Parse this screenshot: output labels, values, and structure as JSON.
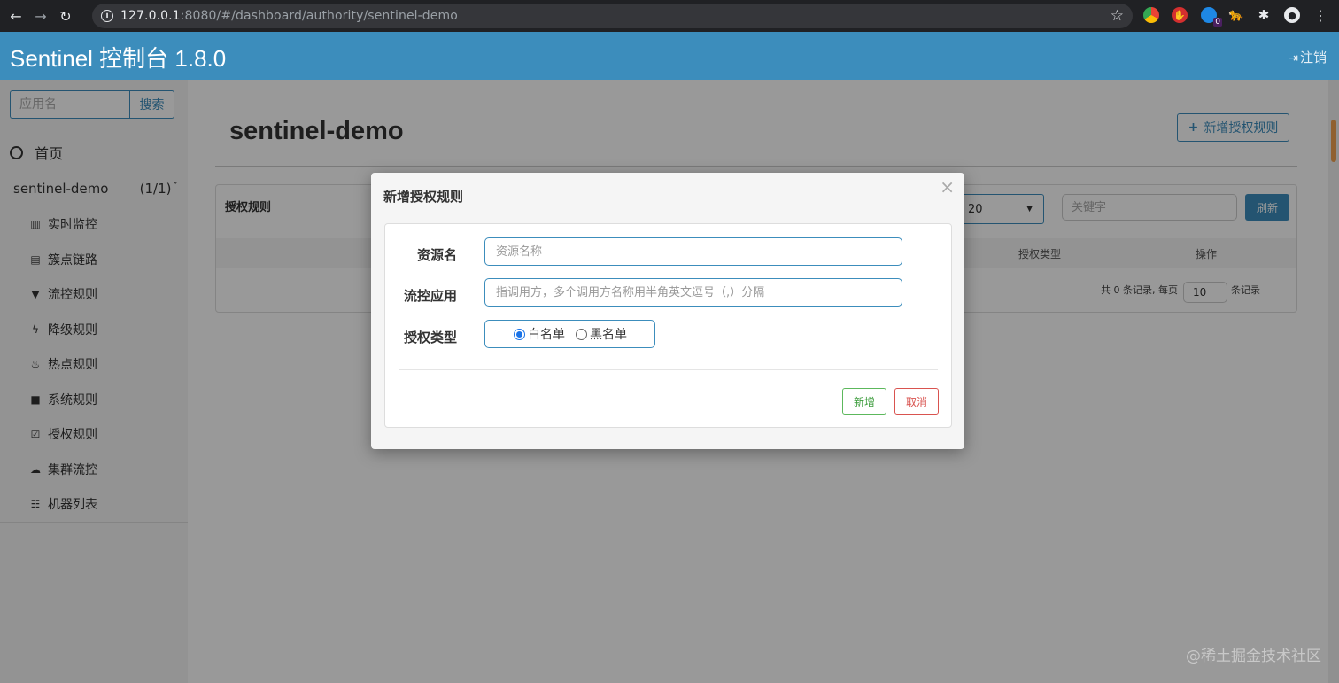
{
  "browser": {
    "url_host": "127.0.0.1",
    "url_rest": ":8080/#/dashboard/authority/sentinel-demo",
    "extension_badge": "0"
  },
  "header": {
    "brand": "Sentinel 控制台 1.8.0",
    "logout_label": "注销"
  },
  "sidebar": {
    "search_placeholder": "应用名",
    "search_button": "搜索",
    "home_label": "首页",
    "app_name": "sentinel-demo",
    "app_count": "(1/1)",
    "items": [
      {
        "label": "实时监控",
        "icon": "bar-chart-icon"
      },
      {
        "label": "簇点链路",
        "icon": "list-icon"
      },
      {
        "label": "流控规则",
        "icon": "filter-icon"
      },
      {
        "label": "降级规则",
        "icon": "flash-icon"
      },
      {
        "label": "热点规则",
        "icon": "fire-icon"
      },
      {
        "label": "系统规则",
        "icon": "lock-icon"
      },
      {
        "label": "授权规则",
        "icon": "check-icon"
      },
      {
        "label": "集群流控",
        "icon": "cloud-icon"
      },
      {
        "label": "机器列表",
        "icon": "th-list-icon"
      }
    ]
  },
  "main": {
    "title": "sentinel-demo",
    "add_button": "新增授权规则",
    "panel_title": "授权规则",
    "page_size": "20",
    "keyword_placeholder": "关键字",
    "refresh_button": "刷新",
    "columns": [
      "授权类型",
      "操作"
    ],
    "pager_prefix": "共 0 条记录, 每页",
    "pager_value": "10",
    "pager_suffix": "条记录"
  },
  "modal": {
    "title": "新增授权规则",
    "close": "×",
    "resource_label": "资源名",
    "resource_placeholder": "资源名称",
    "limit_app_label": "流控应用",
    "limit_app_placeholder": "指调用方，多个调用方名称用半角英文逗号（,）分隔",
    "strategy_label": "授权类型",
    "options": [
      "白名单",
      "黑名单"
    ],
    "selected_option": "白名单",
    "add_button": "新增",
    "cancel_button": "取消"
  },
  "watermark": "@稀土掘金技术社区",
  "colors": {
    "header": "#3c8dbc",
    "accent": "#3c8dbc",
    "success": "#5cb85c",
    "danger": "#d9534f"
  }
}
